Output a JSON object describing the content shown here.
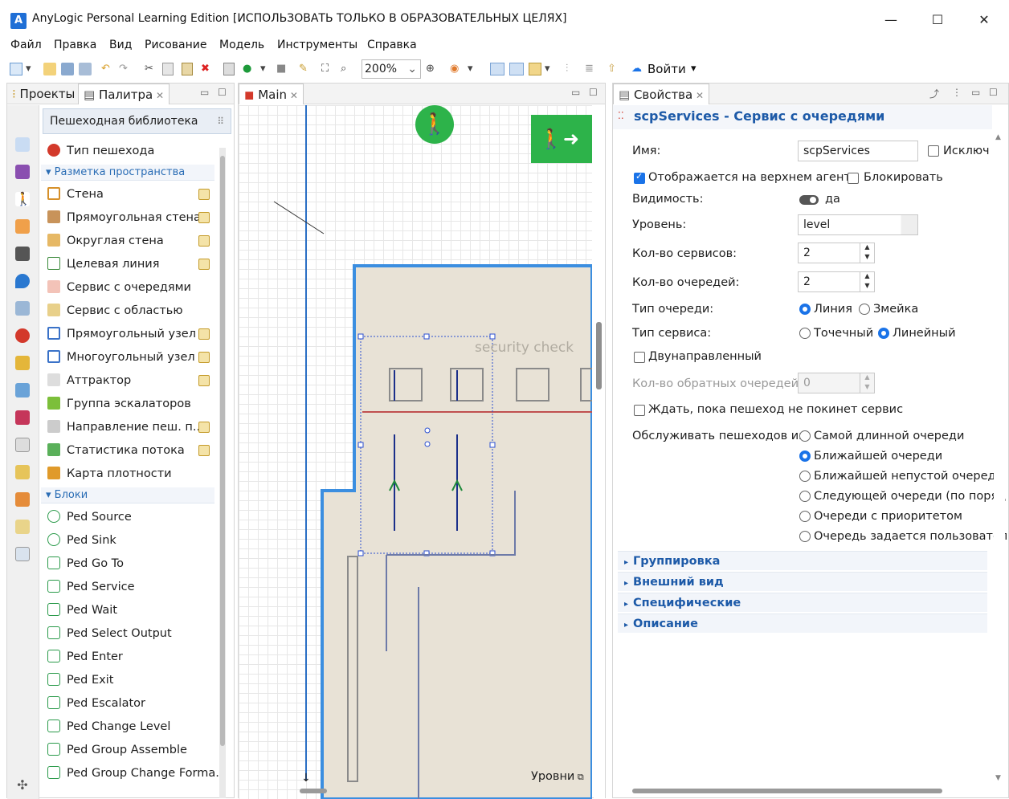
{
  "window": {
    "title": "AnyLogic Personal Learning Edition [ИСПОЛЬЗОВАТЬ ТОЛЬКО В ОБРАЗОВАТЕЛЬНЫХ ЦЕЛЯХ]",
    "logo": "A",
    "minimize": "—",
    "maximize": "☐",
    "close": "✕"
  },
  "menu": [
    "Файл",
    "Правка",
    "Вид",
    "Рисование",
    "Модель",
    "Инструменты",
    "Справка"
  ],
  "toolbar": {
    "zoom": "200%",
    "login": "Войти"
  },
  "left_panel": {
    "tabs": [
      "Проекты",
      "Палитра"
    ],
    "library": "Пешеходная библиотека",
    "top_item": "Тип пешехода",
    "sections": [
      "Разметка пространства",
      "Блоки"
    ],
    "space_items": [
      "Стена",
      "Прямоугольная стена",
      "Округлая стена",
      "Целевая линия",
      "Сервис с очередями",
      "Сервис с областью",
      "Прямоугольный узел",
      "Многоугольный узел",
      "Аттрактор",
      "Группа эскалаторов",
      "Направление пеш. п...",
      "Статистика потока",
      "Карта плотности"
    ],
    "block_items": [
      "Ped Source",
      "Ped Sink",
      "Ped Go To",
      "Ped Service",
      "Ped Wait",
      "Ped Select Output",
      "Ped Enter",
      "Ped Exit",
      "Ped Escalator",
      "Ped Change Level",
      "Ped Group Assemble",
      "Ped Group Change Forma..."
    ]
  },
  "main_panel": {
    "tab": "Main",
    "canvas_label": "security check",
    "levels": "Уровни"
  },
  "properties": {
    "tab": "Свойства",
    "header": "scpServices - Сервис с очередями",
    "name_label": "Имя:",
    "name_value": "scpServices",
    "exclude_label": "Исключ",
    "shown_top_label": "Отображается на верхнем агенте",
    "lock_label": "Блокировать",
    "visibility_label": "Видимость:",
    "visibility_value": "да",
    "level_label": "Уровень:",
    "level_value": "level",
    "services_label": "Кол-во сервисов:",
    "services_value": "2",
    "queues_label": "Кол-во очередей:",
    "queues_value": "2",
    "queue_type_label": "Тип очереди:",
    "queue_type_line": "Линия",
    "queue_type_snake": "Змейка",
    "service_type_label": "Тип сервиса:",
    "service_point": "Точечный",
    "service_linear": "Линейный",
    "bidirectional_label": "Двунаправленный",
    "reverse_queues_label": "Кол-во обратных очередей:",
    "reverse_queues_value": "0",
    "wait_label": "Ждать, пока пешеход не покинет сервис",
    "serve_from_label": "Обслуживать пешеходов из:",
    "serve_options": [
      "Самой длинной очереди",
      "Ближайшей очереди",
      "Ближайшей непустой очереди",
      "Следующей очереди (по поряд",
      "Очереди с приоритетом",
      "Очередь задается пользовател"
    ],
    "groups": [
      "Группировка",
      "Внешний вид",
      "Специфические",
      "Описание"
    ]
  },
  "colors": {
    "accent": "#1a73e8",
    "wall": "#3b8ee0",
    "floor": "#e8e2d6",
    "exit_green": "#2db34a",
    "link_blue": "#1d5aa8"
  }
}
